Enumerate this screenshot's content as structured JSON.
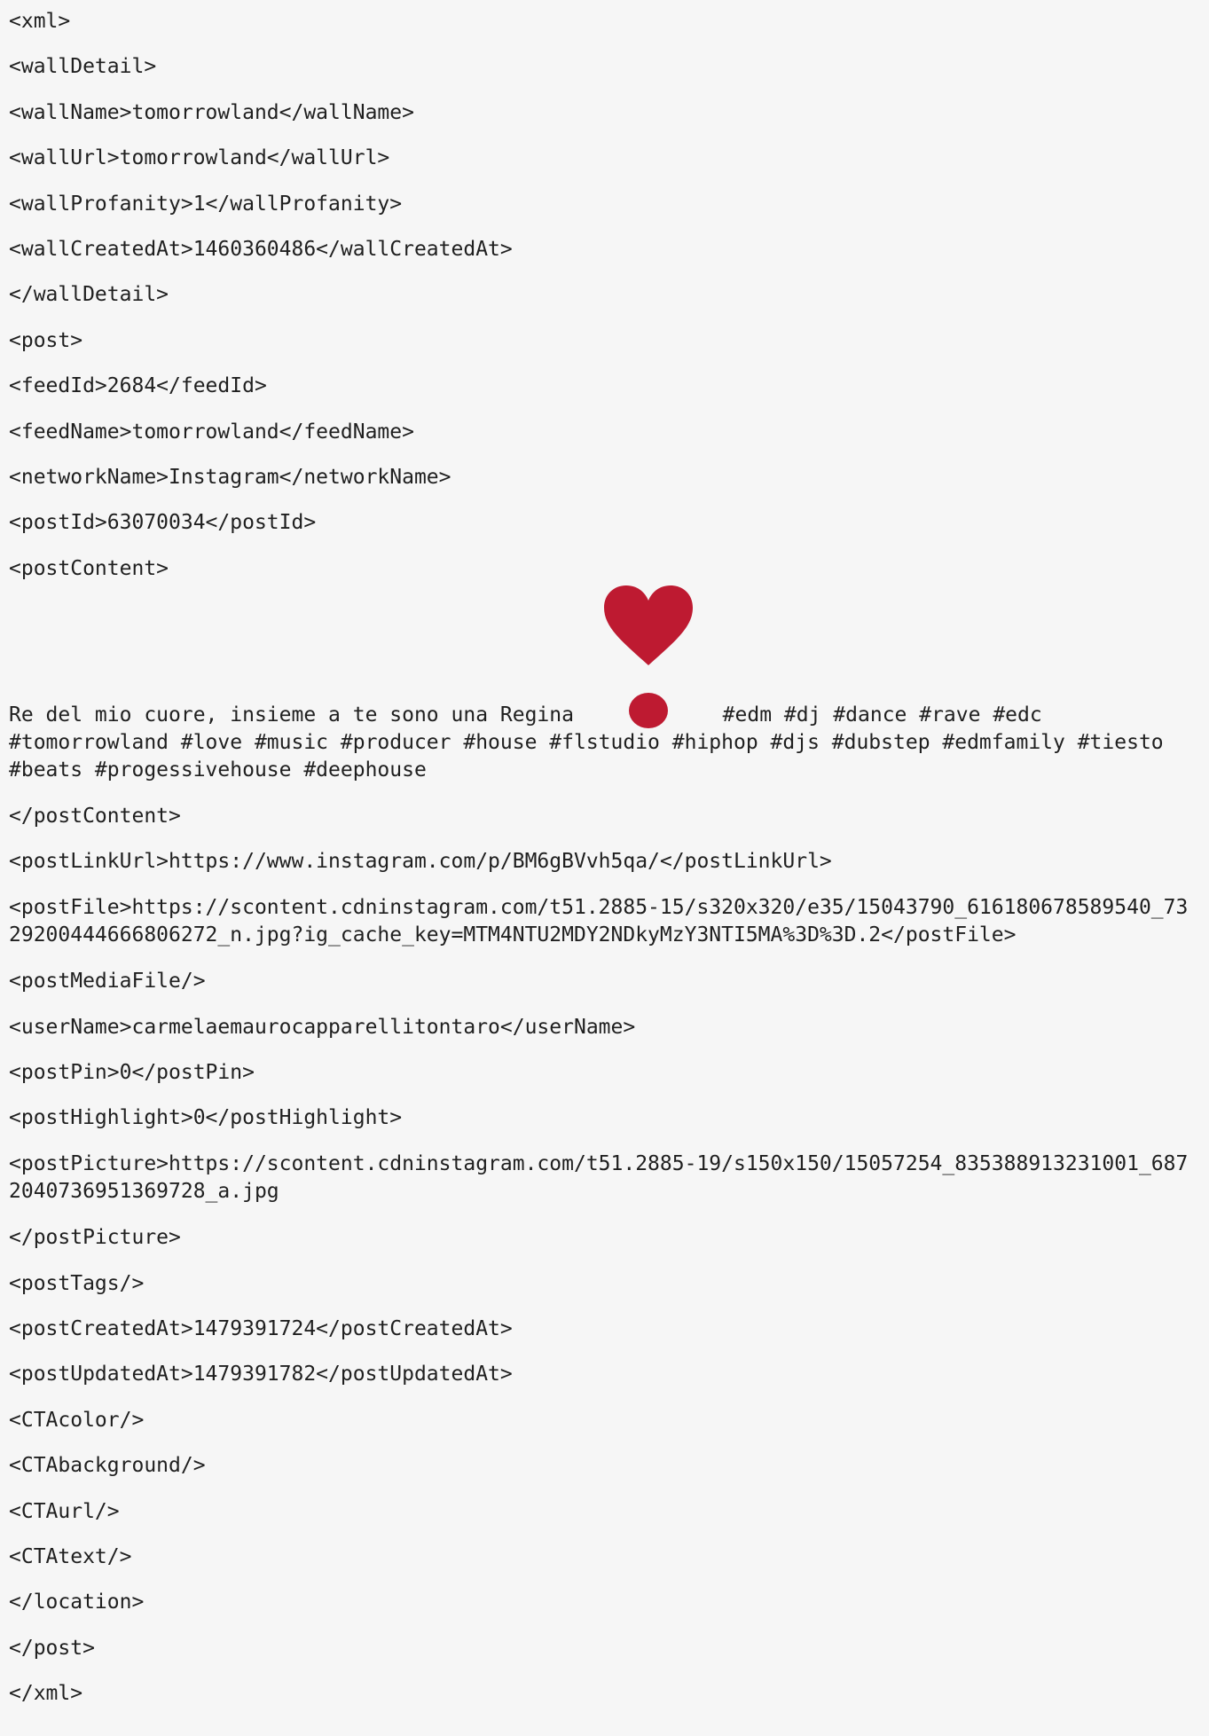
{
  "lines": {
    "xml_open": "<xml>",
    "wallDetail_open": "<wallDetail>",
    "wallName": "<wallName>tomorrowland</wallName>",
    "wallUrl": "<wallUrl>tomorrowland</wallUrl>",
    "wallProfanity": "<wallProfanity>1</wallProfanity>",
    "wallCreatedAt": "<wallCreatedAt>1460360486</wallCreatedAt>",
    "wallDetail_close": "</wallDetail>",
    "post_open": "<post>",
    "feedId": "<feedId>2684</feedId>",
    "feedName": "<feedName>tomorrowland</feedName>",
    "networkName": "<networkName>Instagram</networkName>",
    "postId": "<postId>63070034</postId>",
    "postContent_open": "<postContent>",
    "postContent_text_before": "Re del mio cuore, insieme a te sono una Regina",
    "postContent_text_after": "#edm #dj #dance #rave #edc #tomorrowland #love #music #producer #house #flstudio #hiphop #djs #dubstep #edmfamily #tiesto #beats #progessivehouse #deephouse",
    "postContent_close": "</postContent>",
    "postLinkUrl": "<postLinkUrl>https://www.instagram.com/p/BM6gBVvh5qa/</postLinkUrl>",
    "postFile": "<postFile>https://scontent.cdninstagram.com/t51.2885-15/s320x320/e35/15043790_616180678589540_7329200444666806272_n.jpg?ig_cache_key=MTM4NTU2MDY2NDkyMzY3NTI5MA%3D%3D.2</postFile>",
    "postMediaFile": "<postMediaFile/>",
    "userName": "<userName>carmelaemaurocapparellitontaro</userName>",
    "postPin": "<postPin>0</postPin>",
    "postHighlight": "<postHighlight>0</postHighlight>",
    "postPicture": "<postPicture>https://scontent.cdninstagram.com/t51.2885-19/s150x150/15057254_835388913231001_6872040736951369728_a.jpg",
    "postPicture_close": "</postPicture>",
    "postTags": "<postTags/>",
    "postCreatedAt": "<postCreatedAt>1479391724</postCreatedAt>",
    "postUpdatedAt": "<postUpdatedAt>1479391782</postUpdatedAt>",
    "CTAcolor": "<CTAcolor/>",
    "CTAbackground": "<CTAbackground/>",
    "CTAurl": "<CTAurl/>",
    "CTAtext": "<CTAtext/>",
    "location_close": "</location>",
    "post_close": "</post>",
    "xml_close": "</xml>"
  },
  "emoji": {
    "name": "heavy-heart-exclamation-icon",
    "color": "#be1a31"
  },
  "colors": {
    "background": "#f6f6f6",
    "text": "#1f1f1f"
  }
}
